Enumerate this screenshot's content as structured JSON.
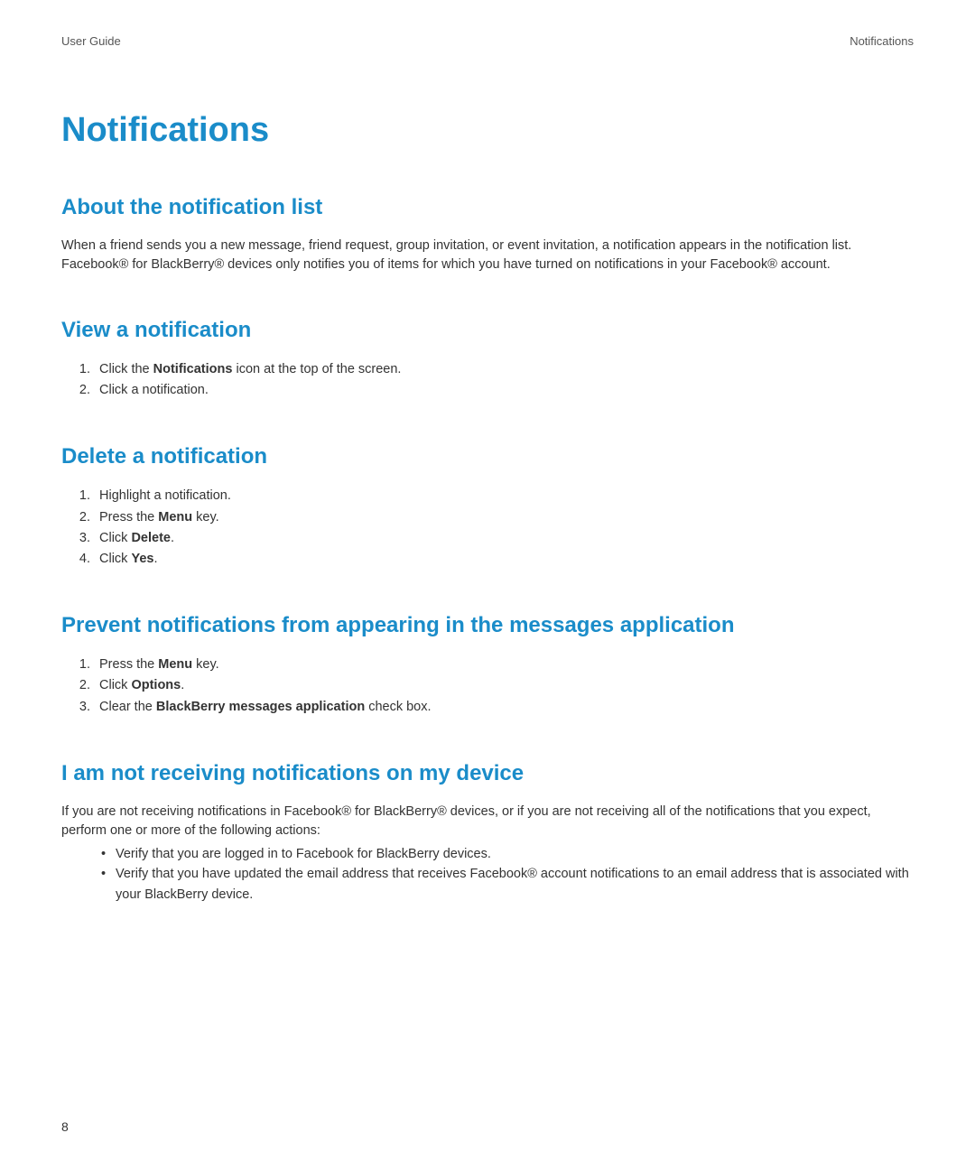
{
  "header": {
    "left": "User Guide",
    "right": "Notifications"
  },
  "title": "Notifications",
  "sections": {
    "about": {
      "heading": "About the notification list",
      "paragraph": "When a friend sends you a new message, friend request, group invitation, or event invitation, a notification appears in the notification list. Facebook® for BlackBerry® devices only notifies you of items for which you have turned on notifications in your Facebook® account."
    },
    "view": {
      "heading": "View a notification",
      "steps": {
        "s1_pre": "Click the ",
        "s1_bold": "Notifications",
        "s1_post": " icon at the top of the screen.",
        "s2": "Click a notification."
      }
    },
    "delete": {
      "heading": "Delete a notification",
      "steps": {
        "s1": "Highlight a notification.",
        "s2_pre": "Press the ",
        "s2_bold": "Menu",
        "s2_post": " key.",
        "s3_pre": "Click ",
        "s3_bold": "Delete",
        "s3_post": ".",
        "s4_pre": "Click ",
        "s4_bold": "Yes",
        "s4_post": "."
      }
    },
    "prevent": {
      "heading": "Prevent notifications from appearing in the messages application",
      "steps": {
        "s1_pre": "Press the ",
        "s1_bold": "Menu",
        "s1_post": " key.",
        "s2_pre": "Click ",
        "s2_bold": "Options",
        "s2_post": ".",
        "s3_pre": "Clear the ",
        "s3_bold": "BlackBerry messages application",
        "s3_post": " check box."
      }
    },
    "notreceiving": {
      "heading": "I am not receiving notifications on my device",
      "paragraph": "If you are not receiving notifications in Facebook® for BlackBerry® devices, or if you are not receiving all of the notifications that you expect, perform one or more of the following actions:",
      "bullets": {
        "b1": "Verify that you are logged in to Facebook for BlackBerry devices.",
        "b2": "Verify that you have updated the email address that receives Facebook® account notifications to an email address that is associated with your BlackBerry device."
      }
    }
  },
  "pageNumber": "8"
}
